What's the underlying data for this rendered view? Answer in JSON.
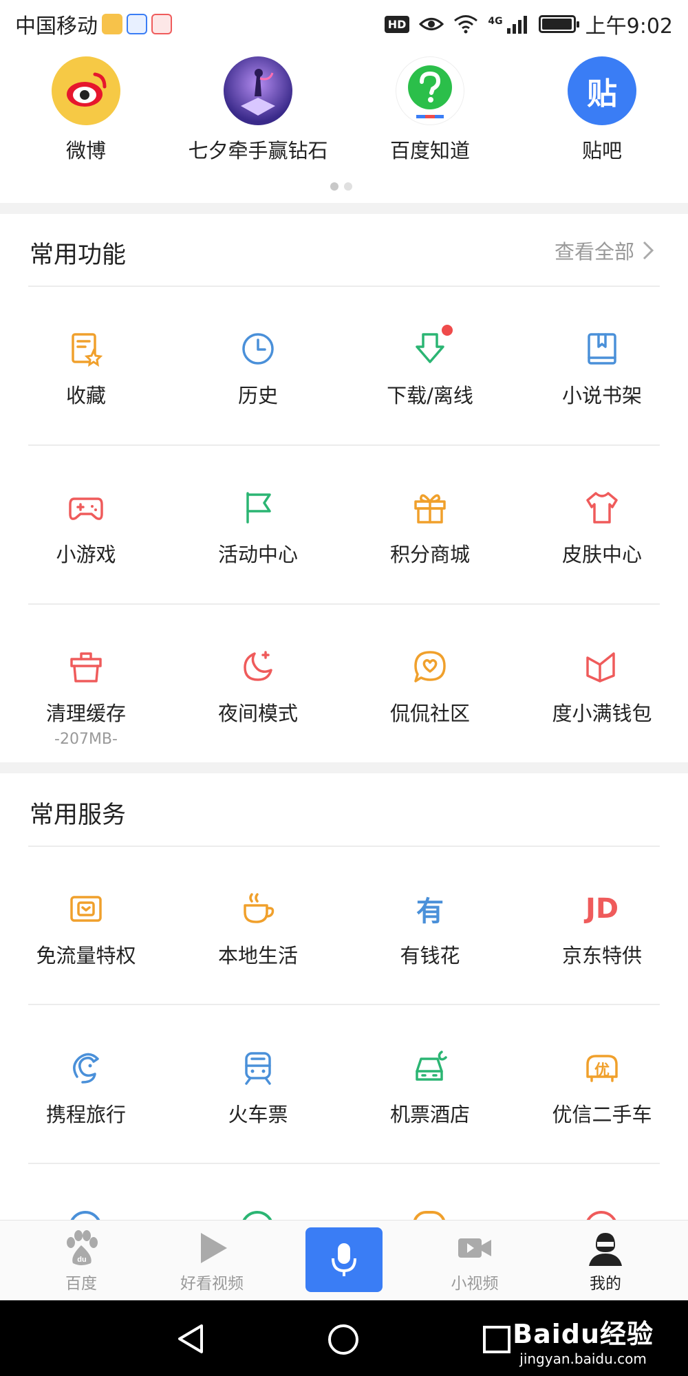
{
  "status_bar": {
    "carrier": "中国移动",
    "time": "上午9:02",
    "hd_label": "HD",
    "network": "4G",
    "battery_level": 0.9
  },
  "top_apps": [
    {
      "label": "微博",
      "icon": "weibo-icon"
    },
    {
      "label": "七夕牵手赢钻石",
      "icon": "qixi-promo-icon"
    },
    {
      "label": "百度知道",
      "icon": "baidu-zhidao-icon"
    },
    {
      "label": "贴吧",
      "icon": "tieba-icon",
      "glyph": "贴"
    }
  ],
  "functions": {
    "title": "常用功能",
    "see_all": "查看全部",
    "items": [
      {
        "label": "收藏",
        "icon": "favorites-icon",
        "color": "#f0a02c"
      },
      {
        "label": "历史",
        "icon": "clock-icon",
        "color": "#4a90d9"
      },
      {
        "label": "下载/离线",
        "icon": "download-icon",
        "color": "#2bb573",
        "badge": true
      },
      {
        "label": "小说书架",
        "icon": "bookshelf-icon",
        "color": "#4a90d9"
      },
      {
        "label": "小游戏",
        "icon": "gamepad-icon",
        "color": "#ef5b5b"
      },
      {
        "label": "活动中心",
        "icon": "flag-icon",
        "color": "#2bb573"
      },
      {
        "label": "积分商城",
        "icon": "gift-icon",
        "color": "#f0a02c"
      },
      {
        "label": "皮肤中心",
        "icon": "shirt-icon",
        "color": "#ef5b5b"
      },
      {
        "label": "清理缓存",
        "icon": "broom-icon",
        "color": "#ef5b5b",
        "sub": "-207MB-"
      },
      {
        "label": "夜间模式",
        "icon": "moon-icon",
        "color": "#ef5b5b"
      },
      {
        "label": "侃侃社区",
        "icon": "chat-heart-icon",
        "color": "#f0a02c"
      },
      {
        "label": "度小满钱包",
        "icon": "wallet-icon",
        "color": "#ef5b5b"
      }
    ]
  },
  "services": {
    "title": "常用服务",
    "items": [
      {
        "label": "免流量特权",
        "icon": "sim-card-icon",
        "color": "#f0a02c"
      },
      {
        "label": "本地生活",
        "icon": "coffee-cup-icon",
        "color": "#f0a02c"
      },
      {
        "label": "有钱花",
        "icon": "youqianhua-icon",
        "color": "#4a90d9",
        "glyph": "有"
      },
      {
        "label": "京东特供",
        "icon": "jd-icon",
        "color": "#ef5b5b",
        "glyph": "JD"
      },
      {
        "label": "携程旅行",
        "icon": "dolphin-icon",
        "color": "#4a90d9"
      },
      {
        "label": "火车票",
        "icon": "train-icon",
        "color": "#4a90d9"
      },
      {
        "label": "机票酒店",
        "icon": "car-moon-icon",
        "color": "#2bb573"
      },
      {
        "label": "优信二手车",
        "icon": "used-car-icon",
        "color": "#f0a02c",
        "glyph": "优"
      }
    ]
  },
  "tabbar": {
    "tabs": [
      {
        "label": "百度",
        "icon": "paw-icon",
        "active": false
      },
      {
        "label": "好看视频",
        "icon": "play-icon",
        "active": false
      },
      {
        "label": "",
        "icon": "microphone-icon",
        "active": false
      },
      {
        "label": "小视频",
        "icon": "video-camera-icon",
        "active": false
      },
      {
        "label": "我的",
        "icon": "user-icon",
        "active": true
      }
    ]
  },
  "watermark": {
    "main": "Baidu经验",
    "sub": "jingyan.baidu.com"
  }
}
